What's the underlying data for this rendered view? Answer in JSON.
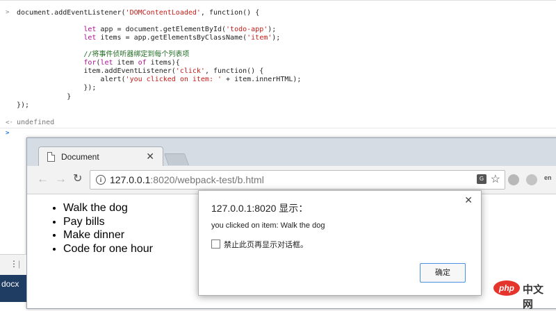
{
  "console": {
    "code_lines": [
      {
        "indent": "",
        "parts": [
          {
            "t": "document.addEventListener(",
            "c": ""
          },
          {
            "t": "'DOMContentLoaded'",
            "c": "str"
          },
          {
            "t": ", function() {",
            "c": ""
          }
        ]
      },
      {
        "indent": "                ",
        "parts": [
          {
            "t": "let",
            "c": "kw"
          },
          {
            "t": " app = document.getElementById(",
            "c": ""
          },
          {
            "t": "'todo-app'",
            "c": "str"
          },
          {
            "t": ");",
            "c": ""
          }
        ]
      },
      {
        "indent": "                ",
        "parts": [
          {
            "t": "let",
            "c": "kw"
          },
          {
            "t": " items = app.getElementsByClassName(",
            "c": ""
          },
          {
            "t": "'item'",
            "c": "str"
          },
          {
            "t": ");",
            "c": ""
          }
        ]
      },
      {
        "indent": "                ",
        "parts": [
          {
            "t": "//将事件侦听器绑定到每个列表项",
            "c": "cm"
          }
        ]
      },
      {
        "indent": "                ",
        "parts": [
          {
            "t": "for",
            "c": "kw"
          },
          {
            "t": "(",
            "c": ""
          },
          {
            "t": "let",
            "c": "kw"
          },
          {
            "t": " item ",
            "c": ""
          },
          {
            "t": "of",
            "c": "kw"
          },
          {
            "t": " items){",
            "c": ""
          }
        ]
      },
      {
        "indent": "                ",
        "parts": [
          {
            "t": "item.addEventListener(",
            "c": ""
          },
          {
            "t": "'click'",
            "c": "str"
          },
          {
            "t": ", function() {",
            "c": ""
          }
        ]
      },
      {
        "indent": "                    ",
        "parts": [
          {
            "t": "alert(",
            "c": ""
          },
          {
            "t": "'you clicked on item: '",
            "c": "str"
          },
          {
            "t": " + item.innerHTML);",
            "c": ""
          }
        ]
      },
      {
        "indent": "                ",
        "parts": [
          {
            "t": "});",
            "c": ""
          }
        ]
      },
      {
        "indent": "            ",
        "parts": [
          {
            "t": "}",
            "c": ""
          }
        ]
      },
      {
        "indent": "",
        "parts": [
          {
            "t": "});",
            "c": ""
          }
        ]
      }
    ],
    "result": "undefined"
  },
  "browser": {
    "tab_title": "Document",
    "url_host": "127.0.0.1",
    "url_rest": ":8020/webpack-test/b.html",
    "translate_glyph": "G",
    "ext_en": "en",
    "todo_items": [
      "Walk the dog",
      "Pay bills",
      "Make dinner",
      "Code for one hour"
    ]
  },
  "left_strip": {
    "label": "docx"
  },
  "dialog": {
    "title": "127.0.0.1:8020 显示：",
    "message": "you clicked on item: Walk the dog",
    "checkbox_label": "禁止此页再显示对话框。",
    "ok_label": "确定"
  },
  "watermark": {
    "logo": "php",
    "text": "中文网"
  }
}
